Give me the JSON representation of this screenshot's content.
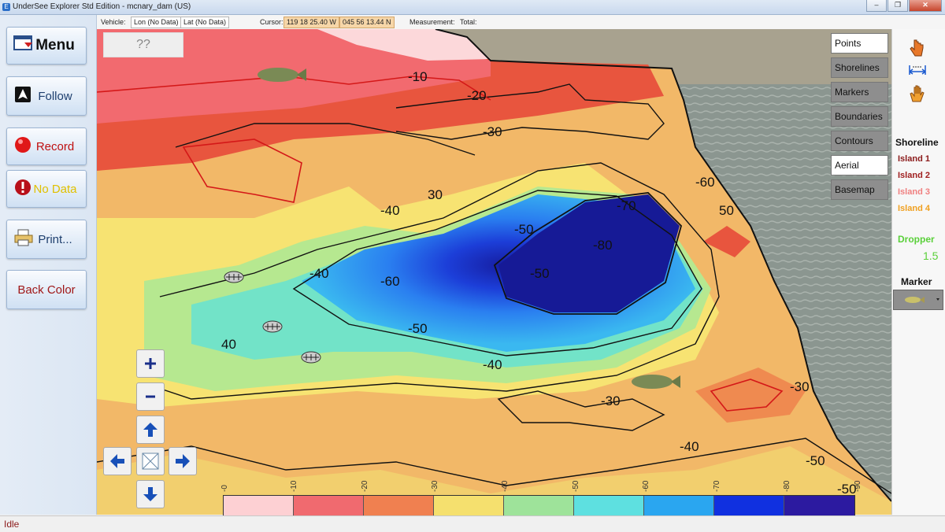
{
  "window": {
    "title": "UnderSee Explorer Std Edition - mcnary_dam (US)",
    "app_icon": "E",
    "btn_min": "–",
    "btn_max": "❐",
    "btn_close": "✕"
  },
  "info": {
    "vehicle_label": "Vehicle:",
    "lon": "Lon (No Data)",
    "lat": "Lat (No Data)",
    "cursor_label": "Cursor:",
    "cursor_lon": "119 18 25.40 W",
    "cursor_lat": "045 56 13.44 N",
    "measurement_label": "Measurement:",
    "total_label": "Total:"
  },
  "sidebar": {
    "menu": "Menu",
    "follow": "Follow",
    "record": "Record",
    "nodata": "No Data",
    "print": "Print...",
    "backcolor": "Back Color"
  },
  "map": {
    "unknown_box": "??",
    "contour_labels": [
      "-10",
      "-20",
      "-30",
      "-40",
      "-50",
      "-60",
      "-70",
      "-80",
      "30",
      "-30",
      "-40",
      "-50",
      "-60",
      "-30",
      "-40",
      "-50",
      "40",
      "50",
      "-50",
      "-50",
      "-40"
    ]
  },
  "layers": [
    {
      "label": "Points",
      "on": true
    },
    {
      "label": "Shorelines",
      "on": false
    },
    {
      "label": "Markers",
      "on": false
    },
    {
      "label": "Boundaries",
      "on": false
    },
    {
      "label": "Contours",
      "on": false
    },
    {
      "label": "Aerial",
      "on": true
    },
    {
      "label": "Basemap",
      "on": false
    }
  ],
  "shoreline": {
    "title": "Shoreline",
    "items": [
      {
        "label": "Island 1",
        "color": "#8b1a1a"
      },
      {
        "label": "Island 2",
        "color": "#a02020"
      },
      {
        "label": "Island 3",
        "color": "#f08080"
      },
      {
        "label": "Island 4",
        "color": "#f0a020"
      }
    ]
  },
  "dropper": {
    "label": "Dropper",
    "value": "1.5",
    "color": "#5ad03a"
  },
  "marker": {
    "label": "Marker"
  },
  "scale_ticks": [
    "-0",
    "-10",
    "-20",
    "-30",
    "-40",
    "-50",
    "-60",
    "-70",
    "-80",
    "-90"
  ],
  "scale_colors": [
    "#fdd0d3",
    "#f06a6f",
    "#f08050",
    "#f5e06e",
    "#9ee39a",
    "#5ee0e0",
    "#2aa6f0",
    "#1030e0",
    "#2c1aa0"
  ],
  "status": {
    "text": "Idle"
  }
}
